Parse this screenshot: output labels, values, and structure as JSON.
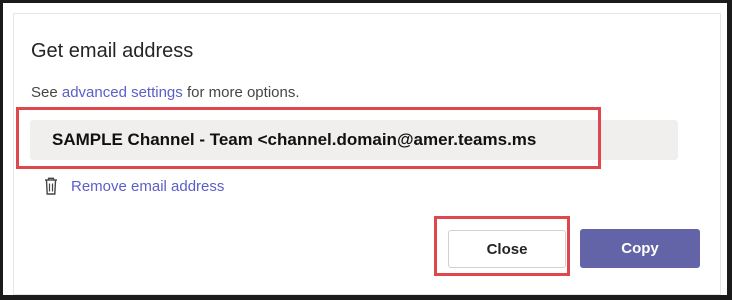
{
  "dialog": {
    "title": "Get email address",
    "subtitle_prefix": "See ",
    "subtitle_link": "advanced settings",
    "subtitle_suffix": " for more options.",
    "email_address": "SAMPLE Channel - Team <channel.domain@amer.teams.ms",
    "remove_label": "Remove email address",
    "close_label": "Close",
    "copy_label": "Copy"
  },
  "icons": {
    "remove": "trash-icon"
  },
  "colors": {
    "accent": "#6264a7",
    "link": "#5b5fc7",
    "annotation_highlight": "#e0474c",
    "address_background": "#f0efee"
  }
}
